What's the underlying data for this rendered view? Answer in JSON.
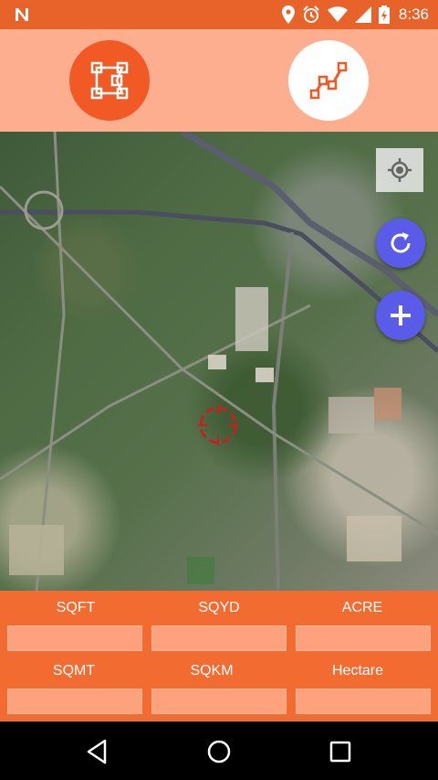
{
  "status_bar": {
    "time": "8:36",
    "icons": [
      "notification-n-icon",
      "location-icon",
      "alarm-icon",
      "wifi-icon",
      "signal-icon",
      "battery-charging-icon"
    ]
  },
  "mode_bar": {
    "buttons": [
      "polygon-area-icon",
      "line-distance-icon"
    ]
  },
  "map_controls": {
    "icons": [
      "my-location-icon",
      "refresh-icon",
      "add-icon"
    ]
  },
  "units": {
    "row1": [
      "SQFT",
      "SQYD",
      "ACRE"
    ],
    "row2": [
      "SQMT",
      "SQKM",
      "Hectare"
    ],
    "values": [
      "",
      "",
      "",
      "",
      "",
      ""
    ]
  },
  "colors": {
    "accent": "#f26b31",
    "mode_bar": "#fcae8f",
    "fab": "#5b5bea"
  }
}
